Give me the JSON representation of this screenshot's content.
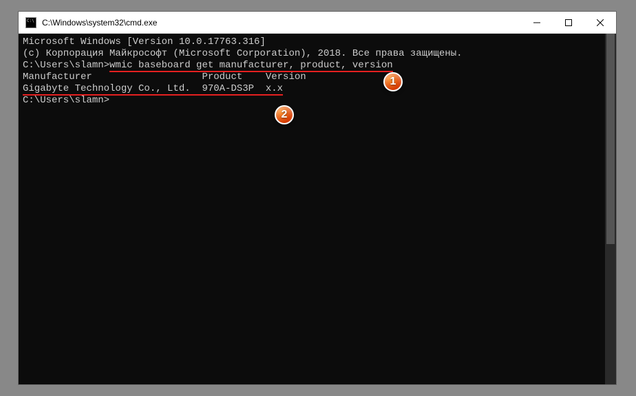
{
  "window": {
    "title": "C:\\Windows\\system32\\cmd.exe"
  },
  "console": {
    "header1": "Microsoft Windows [Version 10.0.17763.316]",
    "header2": "(c) Корпорация Майкрософт (Microsoft Corporation), 2018. Все права защищены.",
    "blank1": "",
    "prompt1_prefix": "C:\\Users\\slamn>",
    "command": "wmic baseboard get manufacturer, product, version",
    "col_headers": "Manufacturer                   Product    Version",
    "row1": "Gigabyte Technology Co., Ltd.  970A-DS3P  x.x",
    "blank2": "",
    "blank3": "",
    "prompt2": "C:\\Users\\slamn>"
  },
  "callouts": {
    "c1": "1",
    "c2": "2"
  }
}
